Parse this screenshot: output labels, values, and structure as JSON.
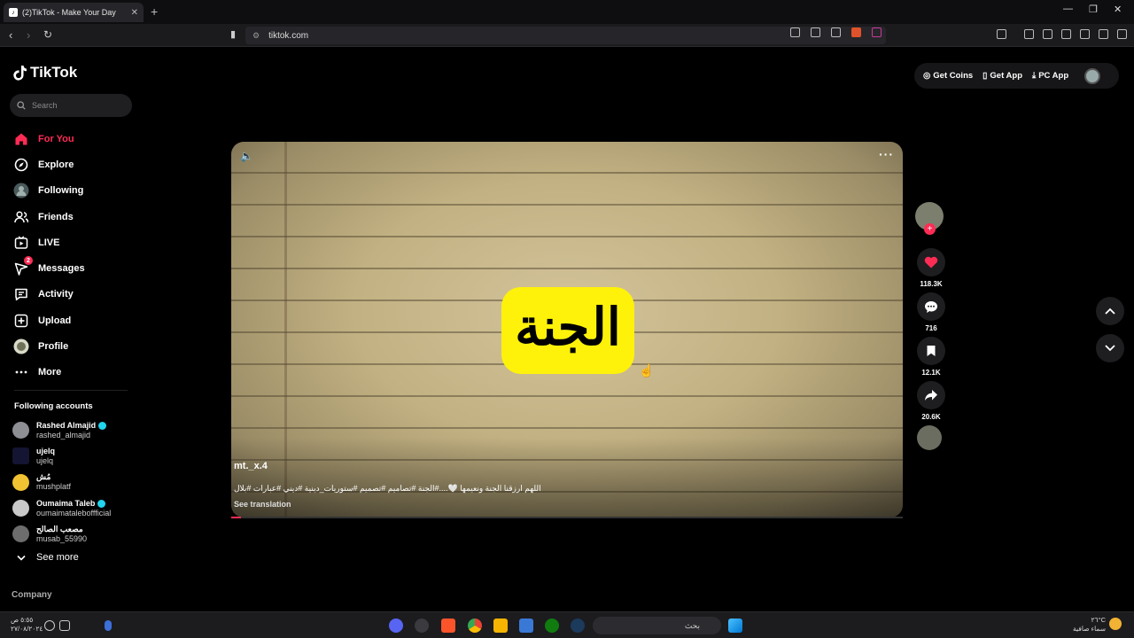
{
  "browser": {
    "tab_title": "(2)TikTok - Make Your Day",
    "url": "tiktok.com"
  },
  "sidebar": {
    "logo_text": "TikTok",
    "search_placeholder": "Search",
    "menu": [
      {
        "label": "For You",
        "icon": "home-icon",
        "active": true
      },
      {
        "label": "Explore",
        "icon": "compass-icon"
      },
      {
        "label": "Following",
        "icon": "following-avatar-icon"
      },
      {
        "label": "Friends",
        "icon": "friends-icon"
      },
      {
        "label": "LIVE",
        "icon": "live-icon"
      },
      {
        "label": "Messages",
        "icon": "messages-icon",
        "badge": "2"
      },
      {
        "label": "Activity",
        "icon": "activity-icon"
      },
      {
        "label": "Upload",
        "icon": "upload-icon"
      },
      {
        "label": "Profile",
        "icon": "profile-avatar-icon"
      },
      {
        "label": "More",
        "icon": "more-icon"
      }
    ],
    "following_title": "Following accounts",
    "following": [
      {
        "name": "Rashed Almajid",
        "handle": "rashed_almajid",
        "verified": true
      },
      {
        "name": "ujelq",
        "handle": "ujelq",
        "verified": false
      },
      {
        "name": "مُش",
        "handle": "mushplatf",
        "verified": false
      },
      {
        "name": "Oumaima Taleb",
        "handle": "oumaimataleboffficial",
        "verified": true
      },
      {
        "name": "مصعب الصالح",
        "handle": "musab_55990",
        "verified": false
      }
    ],
    "see_more": "See more",
    "company": "Company"
  },
  "topbar": {
    "get_coins": "Get Coins",
    "get_app": "Get App",
    "pc_app": "PC App"
  },
  "video": {
    "overlay_text": "الجنة",
    "author": "mt._x.4",
    "description": "اللهم ارزقنا الجنة ونعيمها 🤍....#الجنة #تصاميم #تصميم #ستوريات_دينية #ديني #عبارات #بلال",
    "see_translation": "See translation",
    "progress": 0.0
  },
  "actions": {
    "likes": "118.3K",
    "comments": "716",
    "saves": "12.1K",
    "shares": "20.6K"
  },
  "taskbar": {
    "search_text": "بحث",
    "clock_time": "٥:٥٥ ص",
    "clock_date": "٢٧/٠٨/٢٠٢٤",
    "weather_temp": "٢٦°C",
    "weather_desc": "سماء صافية"
  },
  "colors": {
    "accent": "#fe2c55",
    "video_highlight": "#fff20a"
  }
}
